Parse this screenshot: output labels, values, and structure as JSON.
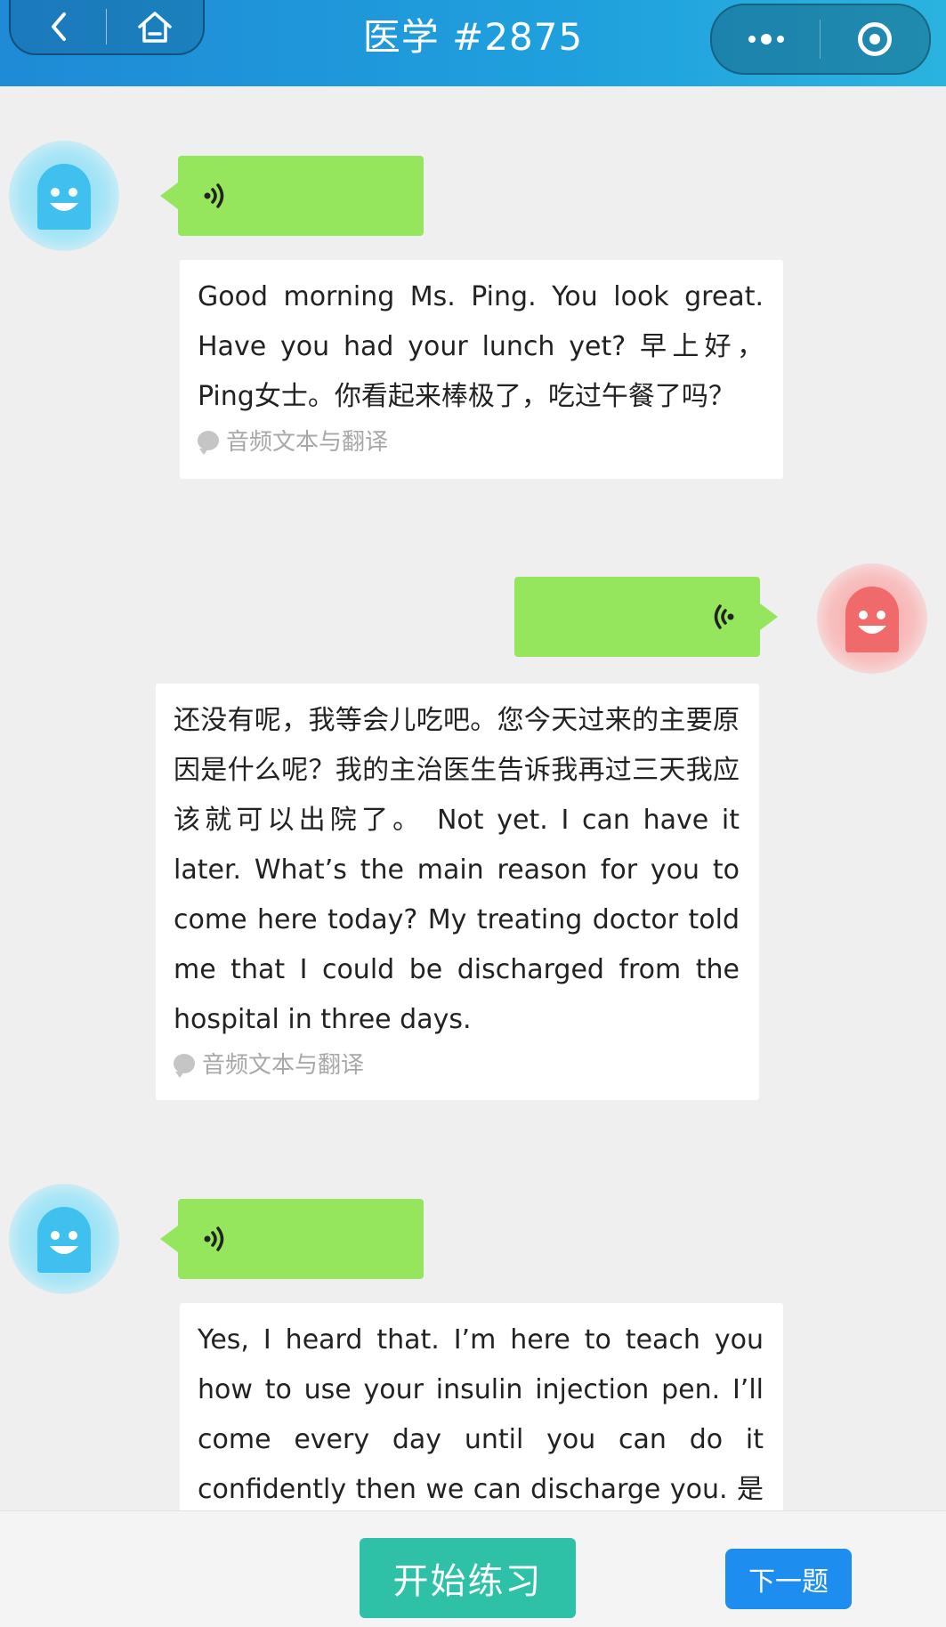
{
  "header": {
    "title": "医学 #2875",
    "back_icon": "chevron-left-icon",
    "home_icon": "home-icon",
    "more_icon": "more-dots-icon",
    "target_icon": "record-target-icon"
  },
  "messages": [
    {
      "side": "left",
      "avatar_color": "#7fdaf3",
      "text": "Good morning Ms. Ping. You look great. Have you had your lunch yet? 早上好，Ping女士。你看起来棒极了，吃过午餐了吗？",
      "translate_label": "音频文本与翻译"
    },
    {
      "side": "right",
      "avatar_color": "#f6a3a4",
      "text": "还没有呢，我等会儿吃吧。您今天过来的主要原因是什么呢？我的主治医生告诉我再过三天我应该就可以出院了。 Not yet. I can have it later. What’s the main reason for you to come here today? My treating doctor told me that I could be discharged from the hospital in three days.",
      "translate_label": "音频文本与翻译"
    },
    {
      "side": "left",
      "avatar_color": "#7fdaf3",
      "text": "Yes, I heard that. I’m here to teach you how to use your insulin injection pen. I’ll come every day until you can do it confidently then we can discharge you. 是的，我听说"
    }
  ],
  "bottom": {
    "start_label": "开始练习",
    "next_label": "下一题"
  },
  "colors": {
    "header": "#1f8ad6",
    "voice_bubble": "#95e65c",
    "start_button": "#2ec1a8",
    "next_button": "#1d8ef0"
  }
}
